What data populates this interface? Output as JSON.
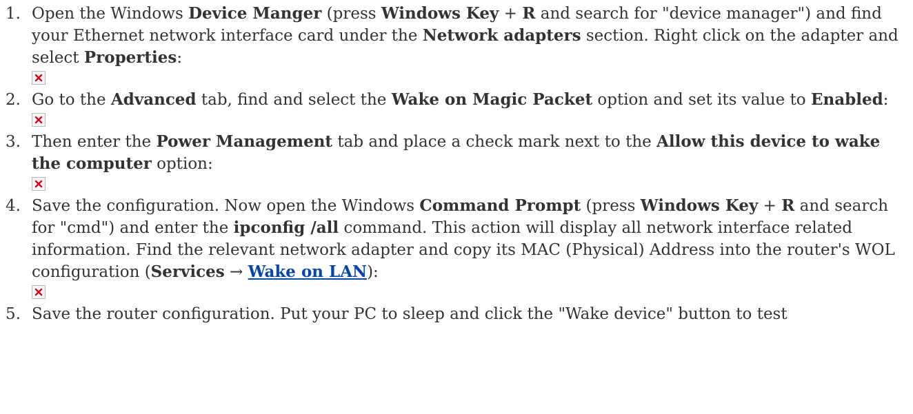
{
  "steps": [
    {
      "number": "1.",
      "parts": [
        "Open the Windows ",
        {
          "b": "Device Manger"
        },
        " (press ",
        {
          "b": "Windows Key"
        },
        " + ",
        {
          "b": "R"
        },
        " and search for \"device manager\") and find your Ethernet network interface card under the ",
        {
          "b": "Network adapters"
        },
        " section. Right click on the adapter and select ",
        {
          "b": "Properties"
        },
        ":"
      ],
      "image_icon": "broken-image-icon"
    },
    {
      "number": "2.",
      "parts": [
        "Go to the ",
        {
          "b": "Advanced"
        },
        " tab, find and select the ",
        {
          "b": "Wake on Magic Packet"
        },
        " option and set its value to ",
        {
          "b": "Enabled"
        },
        ":"
      ],
      "image_icon": "broken-image-icon"
    },
    {
      "number": "3.",
      "parts": [
        "Then enter the ",
        {
          "b": "Power Management"
        },
        " tab and place a check mark next to the ",
        {
          "b": "Allow this device to wake the computer"
        },
        " option:"
      ],
      "image_icon": "broken-image-icon"
    },
    {
      "number": "4.",
      "parts": [
        "Save the configuration. Now open the Windows ",
        {
          "b": "Command Prompt"
        },
        " (press ",
        {
          "b": "Windows Key"
        },
        " + ",
        {
          "b": "R"
        },
        " and search for \"cmd\") and enter the ",
        {
          "b": "ipconfig /all"
        },
        " command. This action will display all network interface related information. Find the relevant network adapter and copy its MAC (Physical) Address into the router's WOL configuration (",
        {
          "b": "Services"
        },
        " → ",
        {
          "link": "Wake on LAN"
        },
        "):"
      ],
      "image_icon": "broken-image-icon"
    },
    {
      "number": "5.",
      "parts": [
        "Save the router configuration. Put your PC to sleep and click the \"Wake device\" button to test"
      ]
    }
  ],
  "colors": {
    "text": "#333333",
    "link": "#0645ad",
    "broken_x": "#d0021b"
  }
}
